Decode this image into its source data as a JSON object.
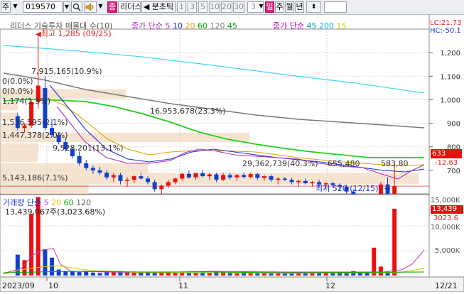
{
  "toolbar": {
    "market_label": "주",
    "code": "019570",
    "zoom_icon": "search-icon",
    "speaker_icon": "speaker-icon",
    "fav_badge": "종",
    "stock_name": "리더스",
    "tick_label": "◀ 분초틱",
    "interval_buttons": [
      "1",
      "3",
      "5",
      "10",
      "20",
      "30"
    ],
    "interval_select": "3",
    "period_buttons": [
      "일",
      "주",
      "월",
      "년"
    ],
    "active_period": "일"
  },
  "price_panel": {
    "title": "리더스 기술투자 매물대 수(10)",
    "ma_title": "종가 단순",
    "ma_periods": [
      "5",
      "10",
      "20",
      "60",
      "120"
    ],
    "ma_colors": [
      "#9b1fb0",
      "#1e2fd0",
      "#e0a000",
      "#00b000",
      "#7a7a7a"
    ],
    "ma2_title": "종가 단순",
    "ma2_periods": [
      "45",
      "200",
      "15"
    ],
    "ma2_colors": [
      "#00a0a0",
      "#00c8ff",
      "#e8c800"
    ],
    "extra_120": "120",
    "extra_45": "45",
    "lc_label": "LC:21.73",
    "hc_label": "HC:-50.1",
    "y_ticks": [
      "1,300",
      "1,200",
      "1,100",
      "1,000",
      "900",
      "800",
      "700",
      "600"
    ],
    "current_price": "633",
    "change_pct": "-12.63",
    "high_label": "최고 1,285 (09/25)",
    "low_label": "최저 520 (12/15)",
    "annotations": [
      "7,915,165(10.9%)",
      "0(0.0%)",
      "0(0.0%)",
      "1,174(1.3%)",
      "16,953,678(23.3%)",
      "1,536,595(2.1%)",
      "1,447,378(2.0%)",
      "9,528,201(13.1%)",
      "29,362,739(40.3%)",
      "655,480",
      "583,80",
      "5,143,186(7.1%)"
    ],
    "volume_profile": [
      10.9,
      0.0,
      0.0,
      1.3,
      23.3,
      2.1,
      2.0,
      13.1,
      40.3,
      7.1
    ]
  },
  "volume_panel": {
    "title": "거래량 단순",
    "ma_periods": [
      "5",
      "20",
      "60",
      "120"
    ],
    "ma_colors": [
      "#c040c0",
      "#e0c000",
      "#00a000",
      "#606060"
    ],
    "volume_label": "13,439,067주(3,023.68%)",
    "y_ticks": [
      "15,000K",
      "10,000K",
      "5,000K"
    ],
    "current_volume": "13,439",
    "volume_ratio": "3023.6"
  },
  "x_axis": {
    "labels": [
      "2023/09",
      "10",
      "11",
      "12",
      "12/21"
    ]
  }
}
